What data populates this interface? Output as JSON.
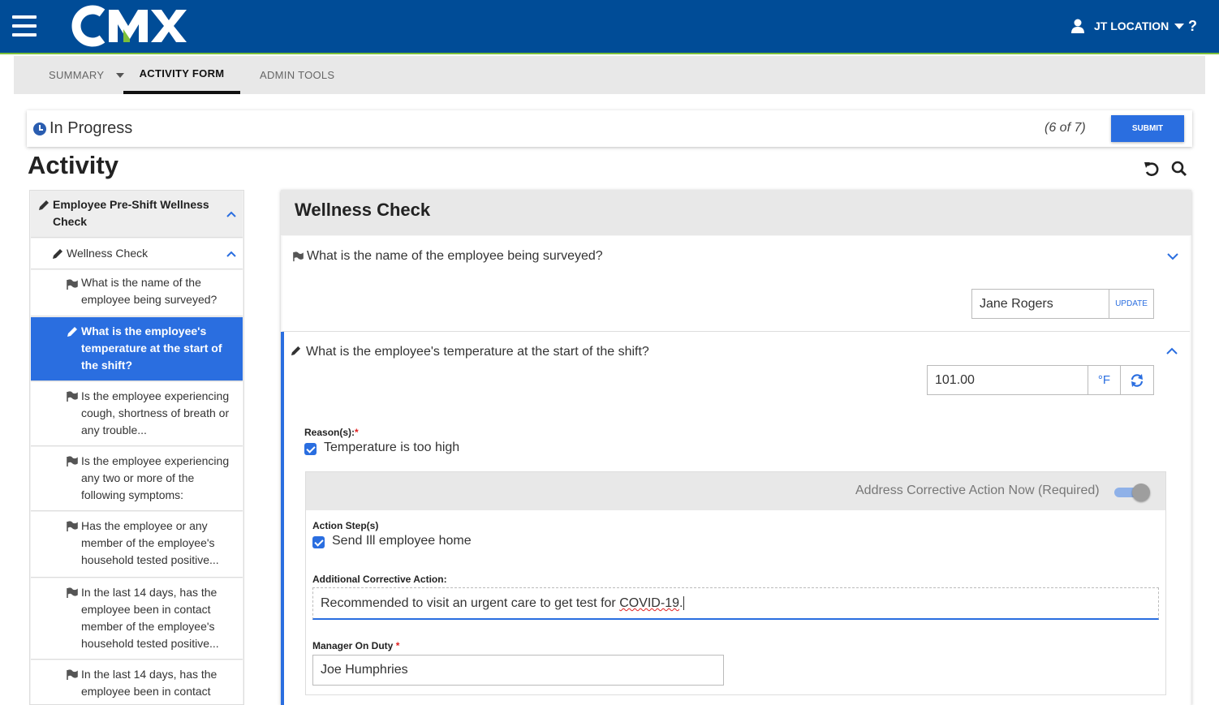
{
  "app": {
    "logo_text": "CMX",
    "user_menu_label": "JT LOCATION",
    "help_label": "?"
  },
  "tabs": [
    {
      "label": "SUMMARY"
    },
    {
      "label": "ACTIVITY FORM"
    },
    {
      "label": "ADMIN TOOLS"
    }
  ],
  "status": {
    "text": "In Progress",
    "progress": "(6 of 7)",
    "submit_label": "SUBMIT"
  },
  "page_title": "Activity",
  "sidebar": {
    "section_title": "Employee Pre-Shift Wellness Check",
    "subsection_title": "Wellness Check",
    "items": [
      {
        "label": "What is the name of the employee being surveyed?"
      },
      {
        "label": "What is the employee's temperature at the start of the shift?"
      },
      {
        "label": "Is the employee experiencing cough, shortness of breath or any trouble..."
      },
      {
        "label": "Is the employee experiencing any two or more of the following symptoms:"
      },
      {
        "label": "Has the employee or any member of the employee's household tested positive..."
      },
      {
        "label": "In the last 14 days, has the employee been in contact member of the employee's household tested positive..."
      },
      {
        "label": "In the last 14 days, has the employee been in contact"
      }
    ]
  },
  "main": {
    "card_title": "Wellness Check",
    "question1": {
      "text": "What is the name of the employee being surveyed?",
      "answer": "Jane Rogers",
      "update_label": "UPDATE"
    },
    "question2": {
      "text": "What is the employee's temperature at the start of the shift?",
      "answer": "101.00",
      "unit": "°F",
      "reasons_label": "Reason(s):",
      "reasons_required": "*",
      "reason": "Temperature is too high",
      "corrective": {
        "toggle_label": "Address Corrective Action Now (Required)",
        "action_steps_label": "Action Step(s)",
        "action_step": "Send Ill employee home",
        "additional_label": "Additional Corrective Action:",
        "additional_value_before": "Recommended to visit an urgent care to get test for ",
        "additional_value_spell": "COVID-19",
        "additional_value_after": ".",
        "manager_label": "Manager On Duty",
        "manager_required": "*",
        "manager_value": "Joe Humphries"
      }
    }
  },
  "colors": {
    "header_bg": "#004c97",
    "accent_green": "#7bbf3a",
    "primary_blue": "#2a6ee0"
  }
}
